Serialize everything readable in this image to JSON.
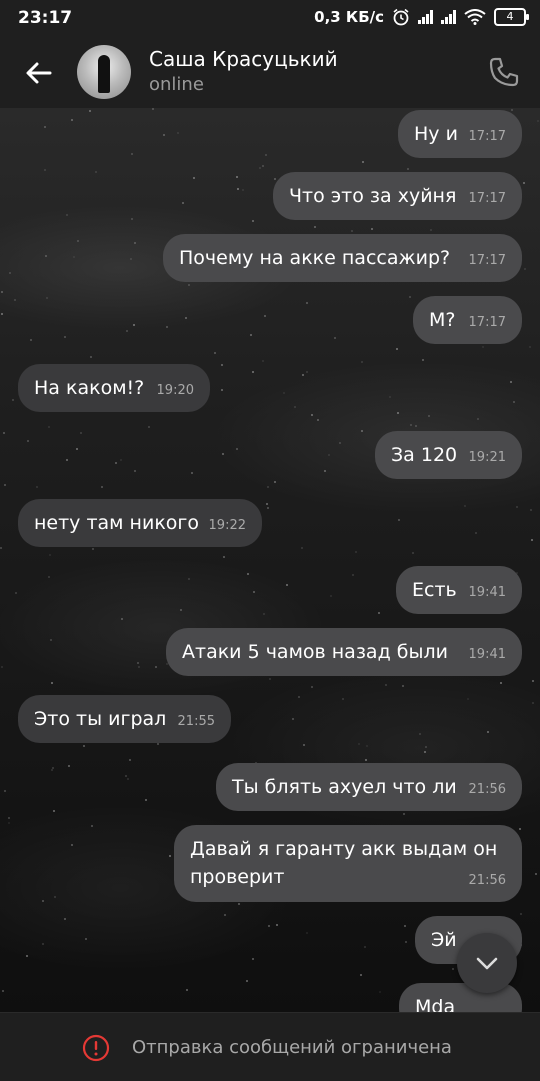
{
  "status_bar": {
    "time": "23:17",
    "network_speed": "0,3 КБ/с",
    "battery_level": "4"
  },
  "header": {
    "contact_name": "Саша Красуцький",
    "contact_status": "online"
  },
  "messages": [
    {
      "text": "Ну и",
      "time": "17:17",
      "direction": "out"
    },
    {
      "text": "Что это за хуйня",
      "time": "17:17",
      "direction": "out"
    },
    {
      "text": "Почему на акке пассажир?",
      "time": "17:17",
      "direction": "out"
    },
    {
      "text": "М?",
      "time": "17:17",
      "direction": "out"
    },
    {
      "text": "На каком!?",
      "time": "19:20",
      "direction": "in"
    },
    {
      "text": "За 120",
      "time": "19:21",
      "direction": "out"
    },
    {
      "text": "нету там никого",
      "time": "19:22",
      "direction": "in"
    },
    {
      "text": "Есть",
      "time": "19:41",
      "direction": "out"
    },
    {
      "text": "Атаки 5 чамов назад были",
      "time": "19:41",
      "direction": "out"
    },
    {
      "text": "Это ты играл",
      "time": "21:55",
      "direction": "in"
    },
    {
      "text": "Ты блять ахуел что ли",
      "time": "21:56",
      "direction": "out"
    },
    {
      "text": "Давай я гаранту акк выдам он\nпроверит",
      "time": "21:56",
      "direction": "out"
    },
    {
      "text": "Эй",
      "time": "",
      "direction": "out"
    },
    {
      "text": "Mda",
      "time": "",
      "direction": "out"
    }
  ],
  "bottom_bar": {
    "restriction_text": "Отправка сообщений ограничена"
  },
  "colors": {
    "outgoing_bubble": "#4a4a4c",
    "incoming_bubble": "#3a3a3c",
    "warning_red": "#e53935"
  }
}
